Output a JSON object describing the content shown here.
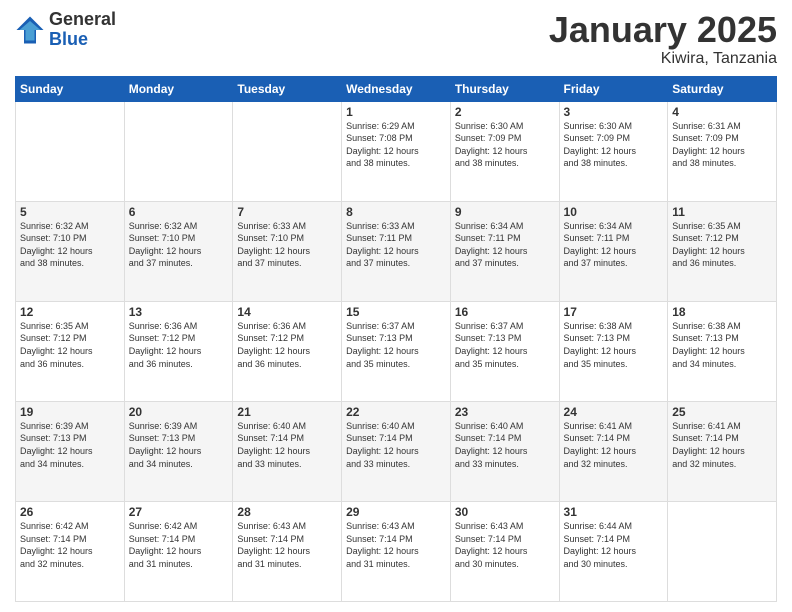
{
  "header": {
    "logo_general": "General",
    "logo_blue": "Blue",
    "month_title": "January 2025",
    "location": "Kiwira, Tanzania"
  },
  "days_of_week": [
    "Sunday",
    "Monday",
    "Tuesday",
    "Wednesday",
    "Thursday",
    "Friday",
    "Saturday"
  ],
  "weeks": [
    [
      {
        "day": "",
        "info": ""
      },
      {
        "day": "",
        "info": ""
      },
      {
        "day": "",
        "info": ""
      },
      {
        "day": "1",
        "info": "Sunrise: 6:29 AM\nSunset: 7:08 PM\nDaylight: 12 hours\nand 38 minutes."
      },
      {
        "day": "2",
        "info": "Sunrise: 6:30 AM\nSunset: 7:09 PM\nDaylight: 12 hours\nand 38 minutes."
      },
      {
        "day": "3",
        "info": "Sunrise: 6:30 AM\nSunset: 7:09 PM\nDaylight: 12 hours\nand 38 minutes."
      },
      {
        "day": "4",
        "info": "Sunrise: 6:31 AM\nSunset: 7:09 PM\nDaylight: 12 hours\nand 38 minutes."
      }
    ],
    [
      {
        "day": "5",
        "info": "Sunrise: 6:32 AM\nSunset: 7:10 PM\nDaylight: 12 hours\nand 38 minutes."
      },
      {
        "day": "6",
        "info": "Sunrise: 6:32 AM\nSunset: 7:10 PM\nDaylight: 12 hours\nand 37 minutes."
      },
      {
        "day": "7",
        "info": "Sunrise: 6:33 AM\nSunset: 7:10 PM\nDaylight: 12 hours\nand 37 minutes."
      },
      {
        "day": "8",
        "info": "Sunrise: 6:33 AM\nSunset: 7:11 PM\nDaylight: 12 hours\nand 37 minutes."
      },
      {
        "day": "9",
        "info": "Sunrise: 6:34 AM\nSunset: 7:11 PM\nDaylight: 12 hours\nand 37 minutes."
      },
      {
        "day": "10",
        "info": "Sunrise: 6:34 AM\nSunset: 7:11 PM\nDaylight: 12 hours\nand 37 minutes."
      },
      {
        "day": "11",
        "info": "Sunrise: 6:35 AM\nSunset: 7:12 PM\nDaylight: 12 hours\nand 36 minutes."
      }
    ],
    [
      {
        "day": "12",
        "info": "Sunrise: 6:35 AM\nSunset: 7:12 PM\nDaylight: 12 hours\nand 36 minutes."
      },
      {
        "day": "13",
        "info": "Sunrise: 6:36 AM\nSunset: 7:12 PM\nDaylight: 12 hours\nand 36 minutes."
      },
      {
        "day": "14",
        "info": "Sunrise: 6:36 AM\nSunset: 7:12 PM\nDaylight: 12 hours\nand 36 minutes."
      },
      {
        "day": "15",
        "info": "Sunrise: 6:37 AM\nSunset: 7:13 PM\nDaylight: 12 hours\nand 35 minutes."
      },
      {
        "day": "16",
        "info": "Sunrise: 6:37 AM\nSunset: 7:13 PM\nDaylight: 12 hours\nand 35 minutes."
      },
      {
        "day": "17",
        "info": "Sunrise: 6:38 AM\nSunset: 7:13 PM\nDaylight: 12 hours\nand 35 minutes."
      },
      {
        "day": "18",
        "info": "Sunrise: 6:38 AM\nSunset: 7:13 PM\nDaylight: 12 hours\nand 34 minutes."
      }
    ],
    [
      {
        "day": "19",
        "info": "Sunrise: 6:39 AM\nSunset: 7:13 PM\nDaylight: 12 hours\nand 34 minutes."
      },
      {
        "day": "20",
        "info": "Sunrise: 6:39 AM\nSunset: 7:13 PM\nDaylight: 12 hours\nand 34 minutes."
      },
      {
        "day": "21",
        "info": "Sunrise: 6:40 AM\nSunset: 7:14 PM\nDaylight: 12 hours\nand 33 minutes."
      },
      {
        "day": "22",
        "info": "Sunrise: 6:40 AM\nSunset: 7:14 PM\nDaylight: 12 hours\nand 33 minutes."
      },
      {
        "day": "23",
        "info": "Sunrise: 6:40 AM\nSunset: 7:14 PM\nDaylight: 12 hours\nand 33 minutes."
      },
      {
        "day": "24",
        "info": "Sunrise: 6:41 AM\nSunset: 7:14 PM\nDaylight: 12 hours\nand 32 minutes."
      },
      {
        "day": "25",
        "info": "Sunrise: 6:41 AM\nSunset: 7:14 PM\nDaylight: 12 hours\nand 32 minutes."
      }
    ],
    [
      {
        "day": "26",
        "info": "Sunrise: 6:42 AM\nSunset: 7:14 PM\nDaylight: 12 hours\nand 32 minutes."
      },
      {
        "day": "27",
        "info": "Sunrise: 6:42 AM\nSunset: 7:14 PM\nDaylight: 12 hours\nand 31 minutes."
      },
      {
        "day": "28",
        "info": "Sunrise: 6:43 AM\nSunset: 7:14 PM\nDaylight: 12 hours\nand 31 minutes."
      },
      {
        "day": "29",
        "info": "Sunrise: 6:43 AM\nSunset: 7:14 PM\nDaylight: 12 hours\nand 31 minutes."
      },
      {
        "day": "30",
        "info": "Sunrise: 6:43 AM\nSunset: 7:14 PM\nDaylight: 12 hours\nand 30 minutes."
      },
      {
        "day": "31",
        "info": "Sunrise: 6:44 AM\nSunset: 7:14 PM\nDaylight: 12 hours\nand 30 minutes."
      },
      {
        "day": "",
        "info": ""
      }
    ]
  ]
}
